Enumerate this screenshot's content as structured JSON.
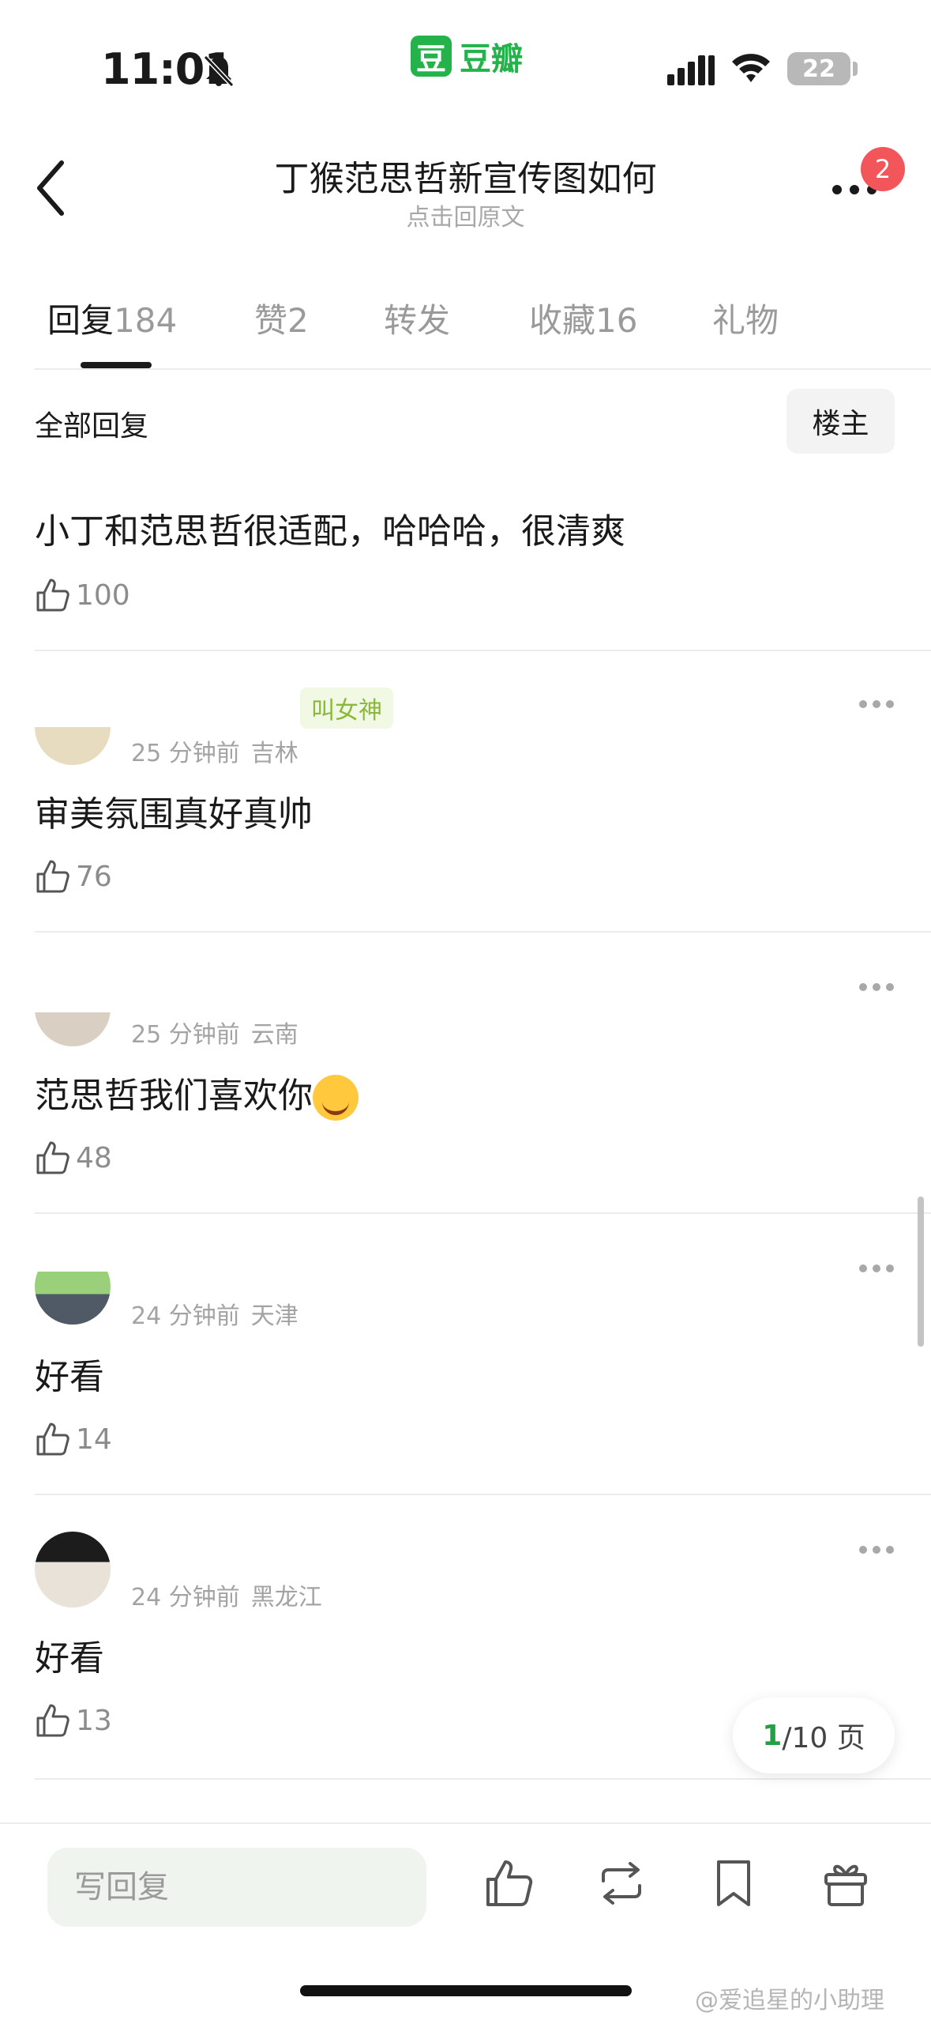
{
  "status_bar": {
    "time": "11:01",
    "battery": "22",
    "app_logo_char": "豆",
    "app_name": "豆瓣"
  },
  "nav": {
    "title": "丁猴范思哲新宣传图如何",
    "subtitle": "点击回原文",
    "notification_count": "2"
  },
  "tabs": [
    {
      "label": "回复",
      "count": "184"
    },
    {
      "label": "赞",
      "count": "2"
    },
    {
      "label": "转发",
      "count": ""
    },
    {
      "label": "收藏",
      "count": "16"
    },
    {
      "label": "礼物",
      "count": ""
    }
  ],
  "filter": {
    "label": "全部回复",
    "owner_button": "楼主"
  },
  "comments": [
    {
      "time": "",
      "location": "",
      "tag": "",
      "text": "小丁和范思哲很适配，哈哈哈，很清爽",
      "likes": "100"
    },
    {
      "time": "25 分钟前",
      "location": "吉林",
      "tag": "叫女神",
      "text": "审美氛围真好真帅",
      "likes": "76"
    },
    {
      "time": "25 分钟前",
      "location": "云南",
      "tag": "",
      "text": "范思哲我们喜欢你",
      "likes": "48"
    },
    {
      "time": "24 分钟前",
      "location": "天津",
      "tag": "",
      "text": "好看",
      "likes": "14"
    },
    {
      "time": "24 分钟前",
      "location": "黑龙江",
      "tag": "",
      "text": "好看",
      "likes": "13"
    }
  ],
  "pager": {
    "current": "1",
    "total_text": "/10 页"
  },
  "bottom_bar": {
    "reply_placeholder": "写回复"
  },
  "watermark": "@爱追星的小助理",
  "colors": {
    "brand_green": "#23b34a",
    "badge_red": "#f2555a",
    "tag_green": "#8ab838"
  }
}
